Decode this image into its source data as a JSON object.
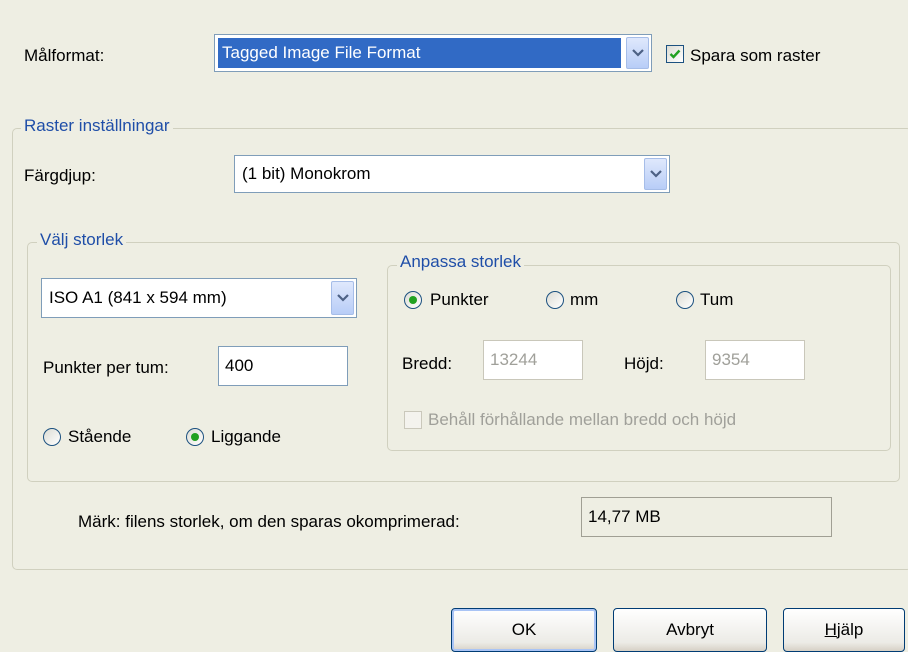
{
  "target_format": {
    "label": "Målformat:",
    "value": "Tagged Image File Format",
    "save_as_raster_label": "Spara som raster",
    "save_as_raster_checked": true
  },
  "raster_settings": {
    "legend": "Raster inställningar",
    "color_depth_label": "Färgdjup:",
    "color_depth_value": "(1 bit) Monokrom"
  },
  "choose_size": {
    "legend": "Välj storlek",
    "paper_size_value": "ISO A1 (841 x 594 mm)",
    "dpi_label": "Punkter per tum:",
    "dpi_value": "400",
    "orientation_portrait": "Stående",
    "orientation_landscape": "Liggande",
    "orientation_selected": "landscape"
  },
  "adjust_size": {
    "legend": "Anpassa storlek",
    "unit_points": "Punkter",
    "unit_mm": "mm",
    "unit_inch": "Tum",
    "unit_selected": "points",
    "width_label": "Bredd:",
    "width_value": "13244",
    "height_label": "Höjd:",
    "height_value": "9354",
    "keep_ratio_label": "Behåll förhållande mellan bredd och höjd"
  },
  "file_size": {
    "label": "Märk: filens storlek, om den sparas okomprimerad:",
    "value": "14,77 MB"
  },
  "buttons": {
    "ok": "OK",
    "cancel": "Avbryt",
    "help": "Hjälp"
  }
}
